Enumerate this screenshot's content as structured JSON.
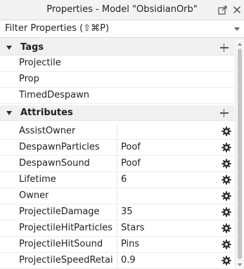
{
  "window": {
    "title": "Properties - Model \"ObsidianOrb\"",
    "undock_icon": "undock-icon",
    "close_icon": "close-icon"
  },
  "filter": {
    "placeholder": "Filter Properties (⇧⌘P)",
    "caret_icon": "chevron-down-icon"
  },
  "sections": {
    "tags": {
      "title": "Tags",
      "items": [
        "Projectile",
        "Prop",
        "TimedDespawn"
      ]
    },
    "attributes": {
      "title": "Attributes",
      "items": [
        {
          "name": "AssistOwner",
          "value": ""
        },
        {
          "name": "DespawnParticles",
          "value": "Poof"
        },
        {
          "name": "DespawnSound",
          "value": "Poof"
        },
        {
          "name": "Lifetime",
          "value": "6"
        },
        {
          "name": "Owner",
          "value": ""
        },
        {
          "name": "ProjectileDamage",
          "value": "35"
        },
        {
          "name": "ProjectileHitParticles",
          "value": "Stars"
        },
        {
          "name": "ProjectileHitSound",
          "value": "Pins"
        },
        {
          "name": "ProjectileSpeedRetain…",
          "value": "0.9"
        }
      ]
    }
  },
  "colors": {
    "header_bg": "#f0f0f0",
    "titlebar_bg": "#f3f3f3",
    "text": "#1f1f1f",
    "icon": "#333333"
  }
}
